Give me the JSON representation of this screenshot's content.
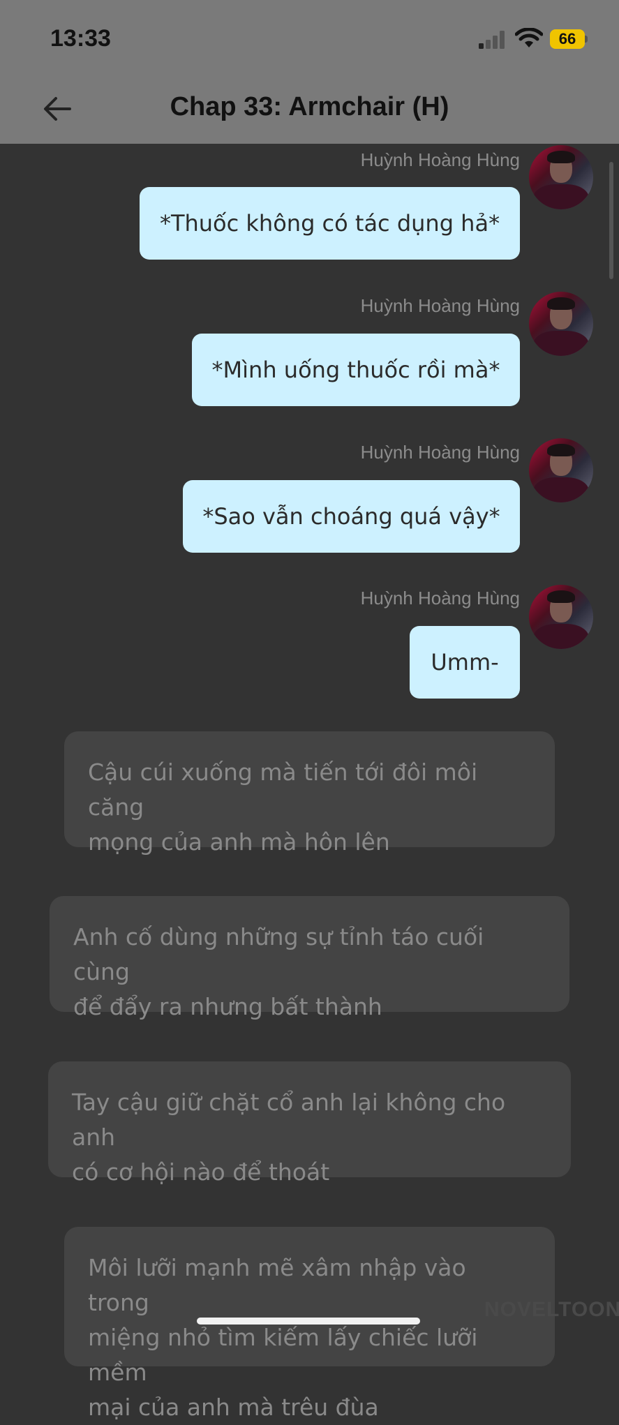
{
  "status": {
    "time": "13:33",
    "battery": "66"
  },
  "header": {
    "title": "Chap 33: Armchair (H)"
  },
  "messages": [
    {
      "author": "Huỳnh Hoàng Hùng",
      "text": "*Thuốc không có tác dụng hả*"
    },
    {
      "author": "Huỳnh Hoàng Hùng",
      "text": "*Mình uống thuốc rồi mà*"
    },
    {
      "author": "Huỳnh Hoàng Hùng",
      "text": "*Sao vẫn choáng quá vậy*"
    },
    {
      "author": "Huỳnh Hoàng Hùng",
      "text": "Umm-"
    }
  ],
  "narrations": [
    {
      "line1": "Cậu cúi xuống mà tiến tới đôi môi căng",
      "line2": "mọng của anh mà hôn lên"
    },
    {
      "line1": "Anh cố dùng những sự tỉnh táo cuối cùng",
      "line2": "để đẩy ra nhưng bất thành"
    },
    {
      "line1": "Tay cậu giữ chặt cổ anh lại không cho anh",
      "line2": "có cơ hội nào để thoát"
    },
    {
      "line1": "Môi lưỡi mạnh mẽ xâm nhập vào trong",
      "line2": "miệng nhỏ tìm kiếm lấy chiếc lưỡi mềm",
      "line3": "mại của anh mà trêu đùa"
    }
  ],
  "watermark": "NOVELTOON",
  "icons": {
    "back": "arrow-left-icon",
    "signal": "cellular-signal-icon",
    "wifi": "wifi-icon",
    "battery": "battery-icon"
  }
}
